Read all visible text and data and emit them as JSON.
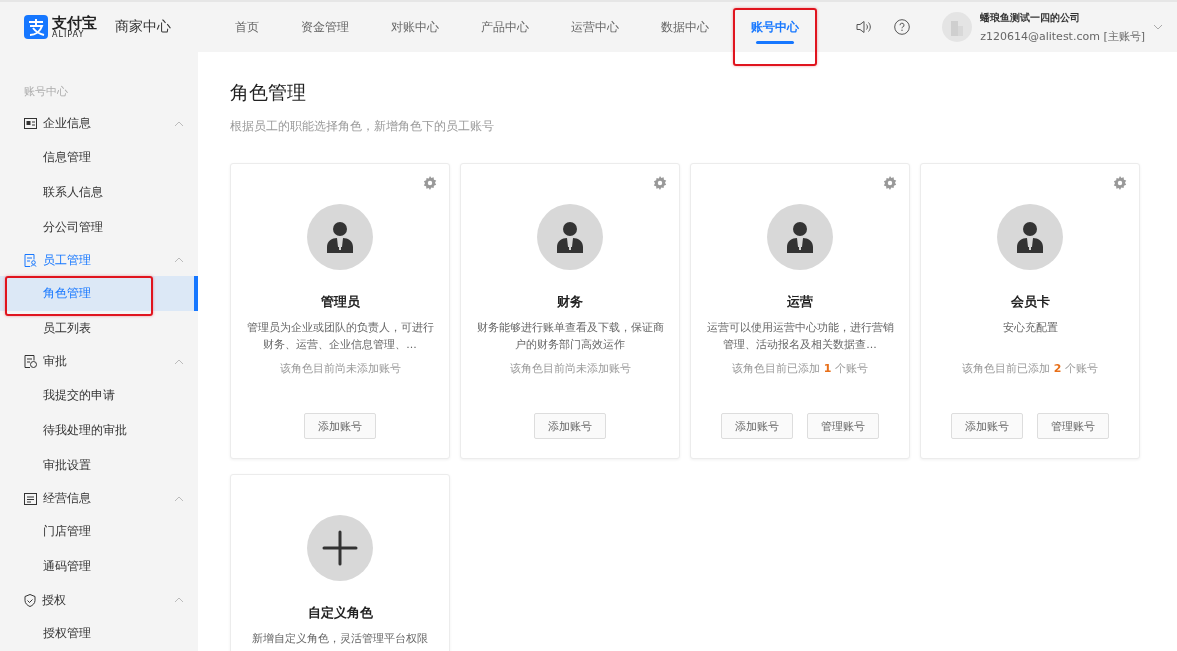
{
  "brand": {
    "logo_text": "支付宝",
    "logo_sub": "ALIPAY",
    "product": "商家中心"
  },
  "nav": [
    {
      "label": "首页",
      "selected": false,
      "highlighted": false
    },
    {
      "label": "资金管理",
      "selected": false,
      "highlighted": false
    },
    {
      "label": "对账中心",
      "selected": false,
      "highlighted": false
    },
    {
      "label": "产品中心",
      "selected": false,
      "highlighted": false
    },
    {
      "label": "运营中心",
      "selected": false,
      "highlighted": false
    },
    {
      "label": "数据中心",
      "selected": false,
      "highlighted": false
    },
    {
      "label": "账号中心",
      "selected": true,
      "highlighted": true
    }
  ],
  "user": {
    "company": "蟠琅鱼测试一四的公司",
    "account": "z120614@alitest.com [主账号]"
  },
  "sidebar": {
    "title": "账号中心",
    "groups": [
      {
        "label": "企业信息",
        "kind": "id",
        "selected": false,
        "expanded": true,
        "items": [
          {
            "label": "信息管理",
            "selected": false,
            "highlighted": false
          },
          {
            "label": "联系人信息",
            "selected": false,
            "highlighted": false
          },
          {
            "label": "分公司管理",
            "selected": false,
            "highlighted": false
          }
        ]
      },
      {
        "label": "员工管理",
        "kind": "staff",
        "selected": true,
        "expanded": true,
        "items": [
          {
            "label": "角色管理",
            "selected": true,
            "highlighted": true
          },
          {
            "label": "员工列表",
            "selected": false,
            "highlighted": false
          }
        ]
      },
      {
        "label": "审批",
        "kind": "approve",
        "selected": false,
        "expanded": true,
        "items": [
          {
            "label": "我提交的申请",
            "selected": false,
            "highlighted": false
          },
          {
            "label": "待我处理的审批",
            "selected": false,
            "highlighted": false
          },
          {
            "label": "审批设置",
            "selected": false,
            "highlighted": false
          }
        ]
      },
      {
        "label": "经营信息",
        "kind": "doc",
        "selected": false,
        "expanded": true,
        "items": [
          {
            "label": "门店管理",
            "selected": false,
            "highlighted": false
          },
          {
            "label": "通码管理",
            "selected": false,
            "highlighted": false
          }
        ]
      },
      {
        "label": "授权",
        "kind": "shield",
        "selected": false,
        "expanded": true,
        "items": [
          {
            "label": "授权管理",
            "selected": false,
            "highlighted": false
          }
        ]
      }
    ]
  },
  "page": {
    "title": "角色管理",
    "subtitle": "根据员工的职能选择角色，新增角色下的员工账号"
  },
  "roles": [
    {
      "kind": "role",
      "name": "管理员",
      "description": "管理员为企业或团队的负责人，可进行财务、运营、企业信息管理、...",
      "accounts": "该角色目前尚未添加账号",
      "buttons": [
        "添加账号"
      ]
    },
    {
      "kind": "role",
      "name": "财务",
      "description": "财务能够进行账单查看及下载，保证商户的财务部门高效运作",
      "accounts": "该角色目前尚未添加账号",
      "buttons": [
        "添加账号"
      ]
    },
    {
      "kind": "role",
      "name": "运营",
      "description": "运营可以使用运营中心功能，进行营销管理、活动报名及相关数据查...",
      "accounts": "该角色目前已添加 **1** 个账号",
      "buttons": [
        "添加账号",
        "管理账号"
      ]
    },
    {
      "kind": "role",
      "name": "会员卡",
      "description": "安心充配置",
      "accounts": "该角色目前已添加 **2** 个账号",
      "buttons": [
        "添加账号",
        "管理账号"
      ]
    },
    {
      "kind": "custom",
      "name": "自定义角色",
      "description": "新增自定义角色，灵活管理平台权限"
    }
  ]
}
